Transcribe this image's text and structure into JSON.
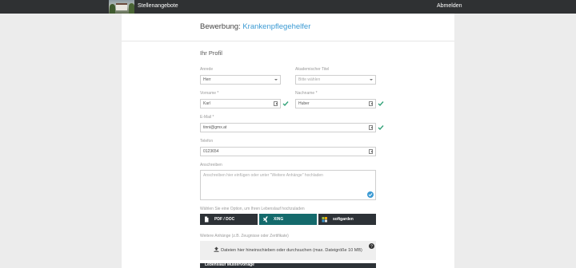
{
  "nav": {
    "title": "Stellenangebote",
    "logout": "Abmelden"
  },
  "page": {
    "title_prefix": "Bewerbung:",
    "title_job": "Krankenpflegehelfer",
    "section": "Ihr Profil"
  },
  "form": {
    "anrede": {
      "label": "Anrede",
      "value": "Herr"
    },
    "titel": {
      "label": "Akademischer Titel",
      "placeholder": "Bitte wählen"
    },
    "vorname": {
      "label": "Vorname *",
      "value": "Karl"
    },
    "nachname": {
      "label": "Nachname *",
      "value": "Huber"
    },
    "email": {
      "label": "E-Mail *",
      "value": "tinni@gmx.at"
    },
    "telefon": {
      "label": "Telefon",
      "value": "0123654"
    },
    "anschreiben": {
      "label": "Anschreiben",
      "placeholder": "Anschreiben hier einfügen oder unter \"Weitere Anhänge\" hochladen"
    }
  },
  "cv": {
    "prompt": "Wählen Sie eine Option, um Ihren Lebenslauf hochzuladen",
    "options": [
      {
        "label": "PDF / DOC",
        "icon": "document-icon"
      },
      {
        "label": "XING",
        "icon": "xing-icon"
      },
      {
        "label": "softgarden",
        "icon": "softgarden-icon"
      }
    ]
  },
  "attachments": {
    "label": "Weitere Anhänge (z.B. Zeugnisse oder Zertifikate)",
    "dropzone": "Dateien hier hineinschieben oder durchsuchen (max. Dateigröße 10 MB)"
  },
  "bottom": {
    "label": "Lebenslauf Mustervorlage"
  },
  "colors": {
    "accent": "#3b9ad3",
    "valid": "#34a37a",
    "xing": "#146a6c",
    "dark": "#2d3237"
  }
}
